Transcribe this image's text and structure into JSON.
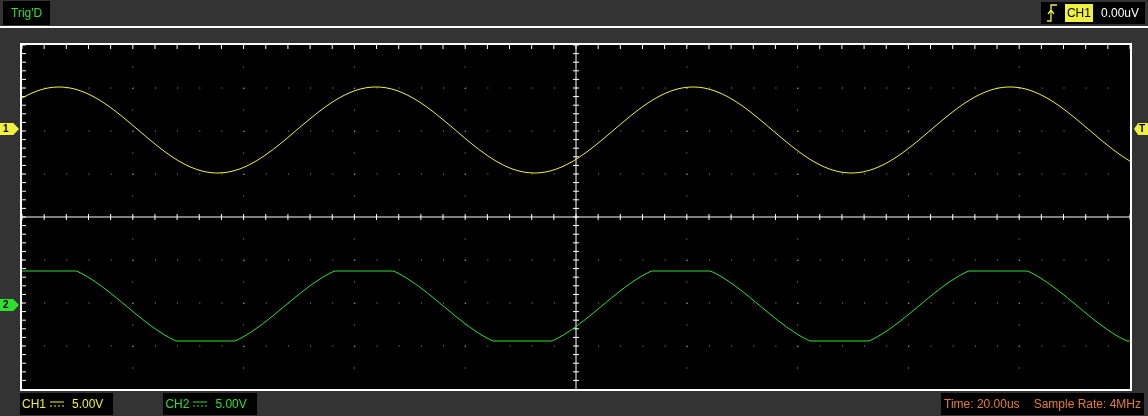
{
  "status": {
    "trigger_state": "Trig'D"
  },
  "trigger": {
    "channel": "CH1",
    "level": "0.00uV",
    "marker": "T"
  },
  "channels": [
    {
      "label": "CH1",
      "scale": "5.00V",
      "marker": "1",
      "color": "#f0f040"
    },
    {
      "label": "CH2",
      "scale": "5.00V",
      "marker": "2",
      "color": "#30e030"
    }
  ],
  "timebase": {
    "time": "Time: 20.00us",
    "sample_rate": "Sample Rate: 4MHz"
  }
}
